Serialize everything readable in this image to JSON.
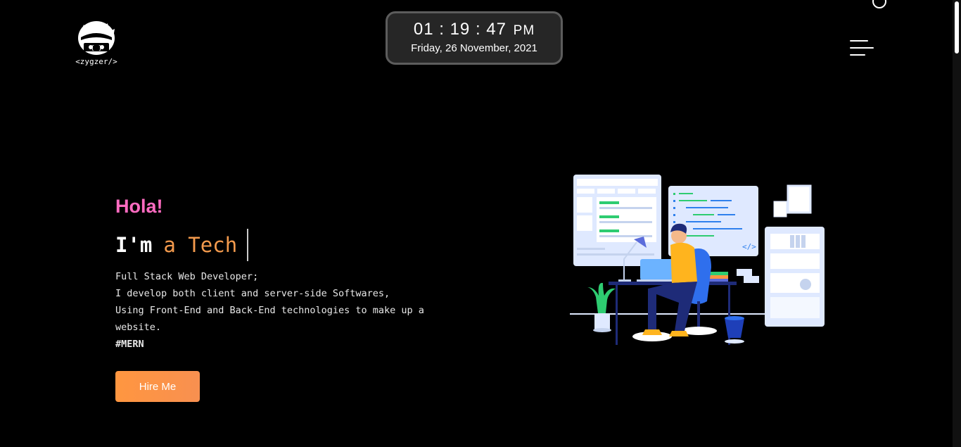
{
  "brand": {
    "logo_label": "<zygzer/>"
  },
  "clock": {
    "hours": "01",
    "minutes": "19",
    "seconds": "47",
    "separator": ":",
    "ampm": "PM",
    "date": "Friday, 26 November, 2021"
  },
  "hero": {
    "greeting": "Hola!",
    "im": "I'm",
    "typed": "a Tech",
    "lines": [
      "Full Stack Web Developer;",
      "I develop both client and server-side Softwares,",
      "Using Front-End and Back-End technologies to make up a website."
    ],
    "hashtag": "#MERN",
    "cta_label": "Hire Me"
  },
  "colors": {
    "background": "#000000",
    "greeting": "#ff6bc1",
    "typed": "#f39a4d",
    "cta": "#ff9640"
  },
  "icons": {
    "menu": "hamburger-menu-icon",
    "logo": "avatar-logo-icon"
  }
}
